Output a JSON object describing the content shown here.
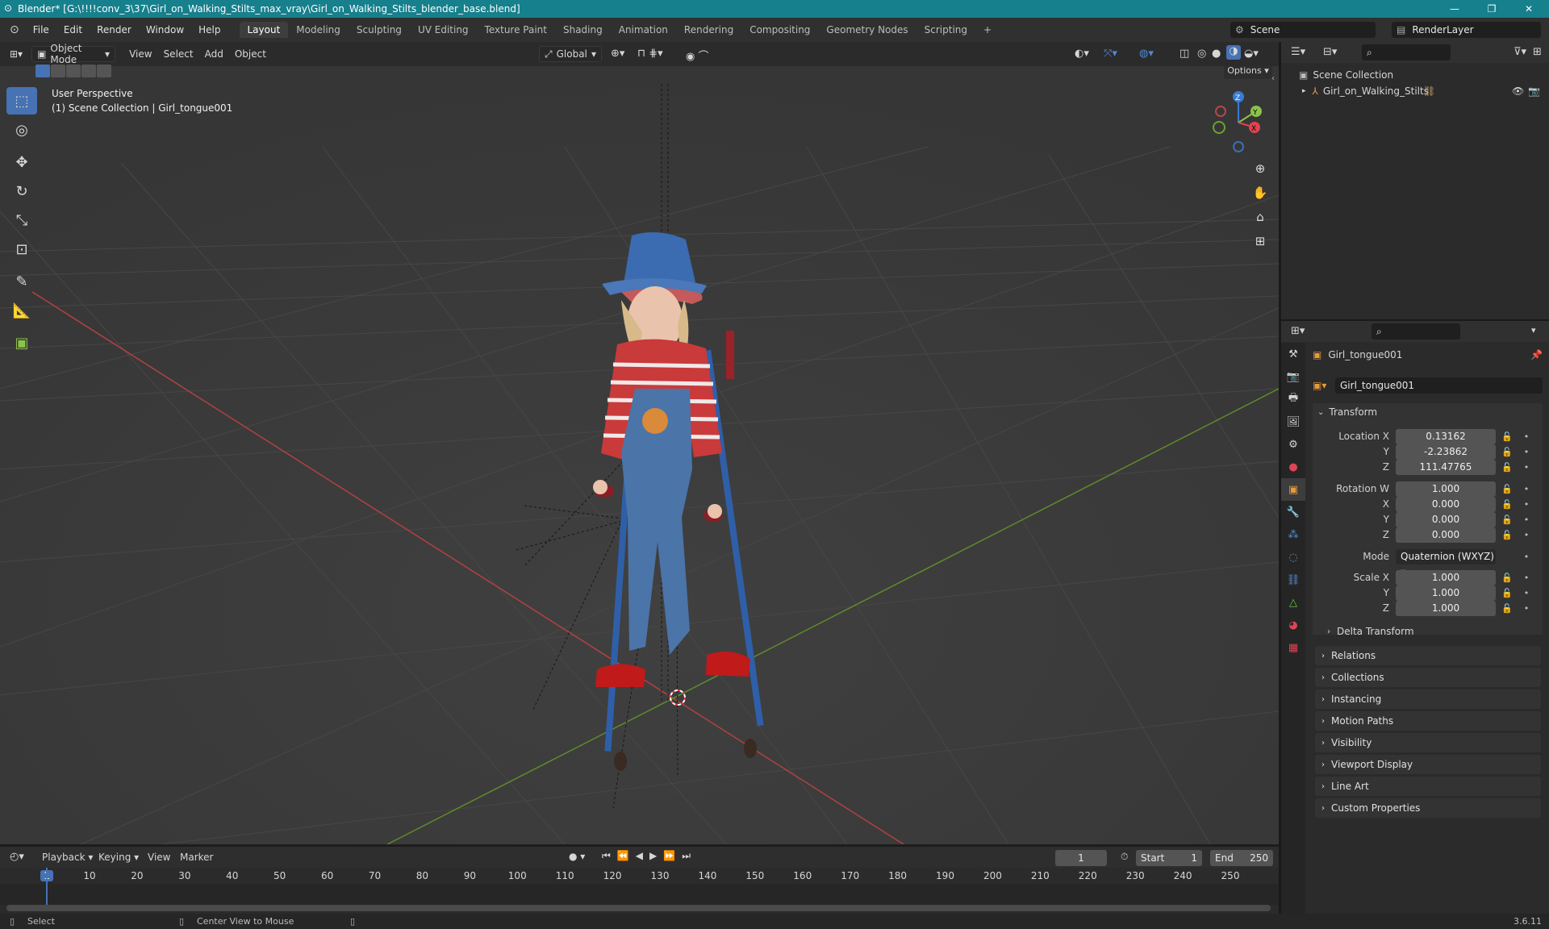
{
  "window": {
    "title": "Blender* [G:\\!!!!conv_3\\37\\Girl_on_Walking_Stilts_max_vray\\Girl_on_Walking_Stilts_blender_base.blend]",
    "minimize": "—",
    "maximize": "❐",
    "close": "✕"
  },
  "menu": [
    "File",
    "Edit",
    "Render",
    "Window",
    "Help"
  ],
  "workspaces": [
    "Layout",
    "Modeling",
    "Sculpting",
    "UV Editing",
    "Texture Paint",
    "Shading",
    "Animation",
    "Rendering",
    "Compositing",
    "Geometry Nodes",
    "Scripting"
  ],
  "add_workspace": "+",
  "scene_label": "Scene",
  "renderlayer_label": "RenderLayer",
  "viewport": {
    "mode": "Object Mode",
    "menus": [
      "View",
      "Select",
      "Add",
      "Object"
    ],
    "orientation": "Global",
    "options": "Options",
    "overlay_line1": "User Perspective",
    "overlay_line2": "(1) Scene Collection | Girl_tongue001",
    "gizmo": {
      "x": "X",
      "y": "Y",
      "z": "Z"
    }
  },
  "tools": [
    {
      "name": "select-box-tool",
      "glyph": "⬚",
      "active": true
    },
    {
      "name": "cursor-tool",
      "glyph": "◎"
    },
    {
      "name": "move-tool",
      "glyph": "✥"
    },
    {
      "name": "rotate-tool",
      "glyph": "↻"
    },
    {
      "name": "scale-tool",
      "glyph": "⤡"
    },
    {
      "name": "transform-tool",
      "glyph": "⊡"
    },
    {
      "name": "annotate-tool",
      "glyph": "✎"
    },
    {
      "name": "measure-tool",
      "glyph": "📐"
    },
    {
      "name": "add-cube-tool",
      "glyph": "▣"
    }
  ],
  "outliner": {
    "root": "Scene Collection",
    "child": "Girl_on_Walking_Stilts"
  },
  "properties": {
    "object_name": "Girl_tongue001",
    "datablock": "Girl_tongue001",
    "transform_header": "Transform",
    "location": {
      "label_x": "Location X",
      "x": "0.13162",
      "label_y": "Y",
      "y": "-2.23862",
      "label_z": "Z",
      "z": "111.47765"
    },
    "rotation": {
      "label_w": "Rotation W",
      "w": "1.000",
      "label_x": "X",
      "x": "0.000",
      "label_y": "Y",
      "y": "0.000",
      "label_z": "Z",
      "z": "0.000"
    },
    "mode_label": "Mode",
    "mode_value": "Quaternion (WXYZ)",
    "scale": {
      "label_x": "Scale X",
      "x": "1.000",
      "label_y": "Y",
      "y": "1.000",
      "label_z": "Z",
      "z": "1.000"
    },
    "delta": "Delta Transform",
    "panels": [
      "Relations",
      "Collections",
      "Instancing",
      "Motion Paths",
      "Visibility",
      "Viewport Display",
      "Line Art",
      "Custom Properties"
    ]
  },
  "timeline": {
    "menus": [
      "Playback",
      "Keying",
      "View",
      "Marker"
    ],
    "current_frame": "1",
    "start_label": "Start",
    "start": "1",
    "end_label": "End",
    "end": "250",
    "ticks": [
      "1",
      "10",
      "20",
      "30",
      "40",
      "50",
      "60",
      "70",
      "80",
      "90",
      "100",
      "110",
      "120",
      "130",
      "140",
      "150",
      "160",
      "170",
      "180",
      "190",
      "200",
      "210",
      "220",
      "230",
      "240",
      "250"
    ]
  },
  "status": {
    "select": "Select",
    "center": "Center View to Mouse",
    "version": "3.6.11"
  },
  "colors": {
    "accent": "#4772b3",
    "titlebar": "#16808c",
    "x_axis": "#d14a4a",
    "y_axis": "#7aa33a"
  }
}
